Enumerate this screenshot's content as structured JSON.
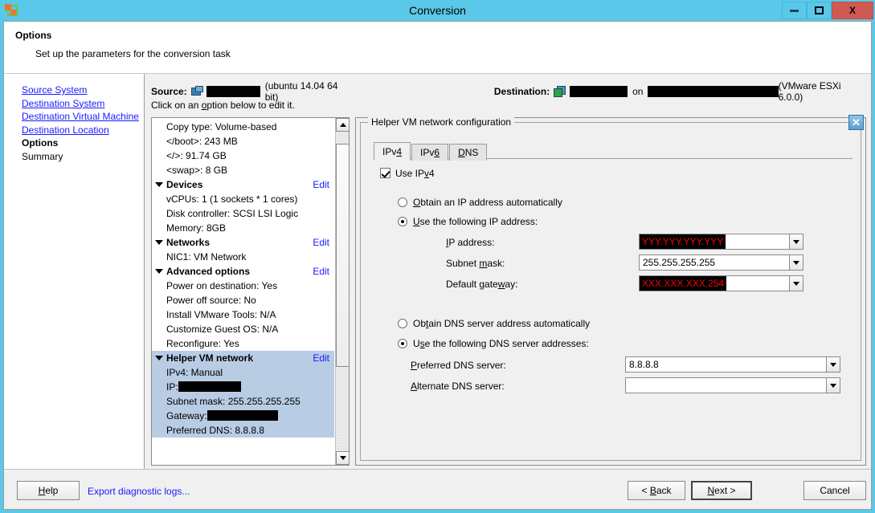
{
  "window": {
    "title": "Conversion",
    "app_icon": "converter-icon",
    "minimize_label": "Minimize",
    "maximize_label": "Maximize",
    "close_label": "X",
    "titlebar_color": "#5ac8e8",
    "close_color": "#cf5a51"
  },
  "page_header": {
    "title": "Options",
    "subtitle": "Set up the parameters for the conversion task"
  },
  "sidebar": {
    "items": [
      {
        "label": "Source System",
        "state": "link"
      },
      {
        "label": "Destination System",
        "state": "link"
      },
      {
        "label": "Destination Virtual Machine",
        "state": "link"
      },
      {
        "label": "Destination Location",
        "state": "link"
      },
      {
        "label": "Options",
        "state": "current"
      },
      {
        "label": "Summary",
        "state": "plain"
      }
    ]
  },
  "source_destination": {
    "source_label": "Source:",
    "source_name_redacted": true,
    "source_name_width": 68,
    "source_os": "(ubuntu 14.04 64 bit)",
    "destination_label": "Destination:",
    "destination_name_redacted": true,
    "destination_name_width": 74,
    "on_word": "on",
    "destination_host_redacted": true,
    "destination_host_width": 166,
    "destination_version": "(VMware ESXi 6.0.0)",
    "hint": "Click on an option below to edit it."
  },
  "options_tree": {
    "edit_label": "Edit",
    "nodes": [
      {
        "text": "Copy type: Volume-based",
        "type": "leaf",
        "selected": false
      },
      {
        "text": "</boot>: 243 MB",
        "type": "leaf",
        "selected": false
      },
      {
        "text": "</>: 91.74 GB",
        "type": "leaf",
        "selected": false
      },
      {
        "text": "<swap>: 8 GB",
        "type": "leaf",
        "selected": false
      },
      {
        "text": "Devices",
        "type": "group",
        "edit": "Edit",
        "selected": false
      },
      {
        "text": "vCPUs: 1 (1 sockets * 1 cores)",
        "type": "leaf",
        "selected": false
      },
      {
        "text": "Disk controller: SCSI LSI Logic",
        "type": "leaf",
        "selected": false
      },
      {
        "text": "Memory: 8GB",
        "type": "leaf",
        "selected": false
      },
      {
        "text": "Networks",
        "type": "group",
        "edit": "Edit",
        "selected": false
      },
      {
        "text": "NIC1: VM Network",
        "type": "leaf",
        "selected": false
      },
      {
        "text": "Advanced options",
        "type": "group",
        "edit": "Edit",
        "selected": false
      },
      {
        "text": "Power on destination: Yes",
        "type": "leaf",
        "selected": false
      },
      {
        "text": "Power off source: No",
        "type": "leaf",
        "selected": false
      },
      {
        "text": "Install VMware Tools: N/A",
        "type": "leaf",
        "selected": false
      },
      {
        "text": "Customize Guest OS: N/A",
        "type": "leaf",
        "selected": false
      },
      {
        "text": "Reconfigure: Yes",
        "type": "leaf",
        "selected": false
      },
      {
        "text": "Helper VM network",
        "type": "group",
        "edit": "Edit",
        "selected": true
      },
      {
        "text": "IPv4: Manual",
        "type": "leaf",
        "selected": true
      },
      {
        "text": "IP:",
        "type": "leaf-redacted",
        "redact_width": 78,
        "selected": true
      },
      {
        "text": "Subnet mask: 255.255.255.255",
        "type": "leaf",
        "selected": true
      },
      {
        "text": "Gateway:",
        "type": "leaf-redacted",
        "redact_width": 88,
        "selected": true
      },
      {
        "text": "Preferred DNS: 8.8.8.8",
        "type": "leaf",
        "selected": true
      }
    ]
  },
  "config_panel": {
    "legend": "Helper VM network configuration",
    "close_icon": "close-icon",
    "close_glyph": "✕",
    "tabs": [
      {
        "label": "IPv4",
        "active": true
      },
      {
        "label": "IPv6",
        "active": false
      },
      {
        "label": "DNS",
        "active": false
      }
    ],
    "use_ipv4": {
      "label": "Use IPv4",
      "checked": true
    },
    "ip_mode": {
      "auto_label": "Obtain an IP address automatically",
      "auto_selected": false,
      "manual_label": "Use the following IP address:",
      "manual_selected": true
    },
    "fields": [
      {
        "label": "IP address:",
        "value": "YYY.YYY.YYY.YYY",
        "redacted": true,
        "value_color": "#ff0000"
      },
      {
        "label": "Subnet mask:",
        "value": "255.255.255.255",
        "redacted": false,
        "value_color": "#000000"
      },
      {
        "label": "Default gateway:",
        "value": "XXX.XXX.XXX.254",
        "redacted": true,
        "value_color": "#ff0000"
      }
    ],
    "dns_mode": {
      "auto_label": "Obtain DNS server address automatically",
      "auto_selected": false,
      "manual_label": "Use the following DNS server addresses:",
      "manual_selected": true
    },
    "dns_fields": [
      {
        "label": "Preferred DNS server:",
        "value": "8.8.8.8"
      },
      {
        "label": "Alternate DNS server:",
        "value": ""
      }
    ]
  },
  "footer": {
    "help": "Help",
    "export_logs": "Export diagnostic logs...",
    "back": "< Back",
    "next": "Next >",
    "cancel": "Cancel"
  }
}
